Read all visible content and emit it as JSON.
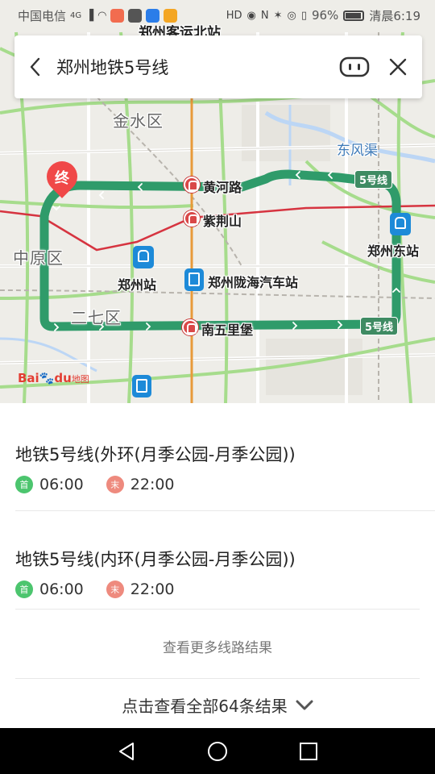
{
  "status_bar": {
    "carrier": "中国电信",
    "network": "4G",
    "battery": "96%",
    "time": "清晨6:19"
  },
  "search": {
    "query": "郑州地铁5号线"
  },
  "map": {
    "place_labels": {
      "top_station": "郑州客运北站",
      "district_jinshui": "金水区",
      "district_zhongyuan": "中原区",
      "district_erqi": "二七区",
      "canal": "东风渠",
      "huanghe_road": "黄河路",
      "zijingshan": "紫荆山",
      "zhengzhou_station": "郑州站",
      "longhai_bus": "郑州陇海汽车站",
      "nanwulibao": "南五里堡",
      "east_station": "郑州东站"
    },
    "line_badge_1": "5号线",
    "line_badge_2": "5号线",
    "end_marker": "终",
    "logo": {
      "bai": "Bai",
      "du": "du",
      "ditu": "地图"
    },
    "colors": {
      "route": "#2f9b6a",
      "road_green": "#a6dc8c",
      "line_red": "#d63440",
      "line_orange": "#e89a3a",
      "water": "#bcd6f5"
    }
  },
  "results": [
    {
      "title": "地铁5号线(外环(月季公园-月季公园))",
      "first_tag": "首",
      "first_time": "06:00",
      "last_tag": "末",
      "last_time": "22:00"
    },
    {
      "title": "地铁5号线(内环(月季公园-月季公园))",
      "first_tag": "首",
      "first_time": "06:00",
      "last_tag": "末",
      "last_time": "22:00"
    }
  ],
  "more_lines": "查看更多线路结果",
  "all_results": "点击查看全部64条结果",
  "icons": {
    "back": "chevron-left-icon",
    "voice": "voice-icon",
    "close": "close-icon",
    "expand": "chevron-down-icon",
    "nav_back": "triangle-back-icon",
    "nav_home": "circle-home-icon",
    "nav_recents": "square-recents-icon"
  }
}
